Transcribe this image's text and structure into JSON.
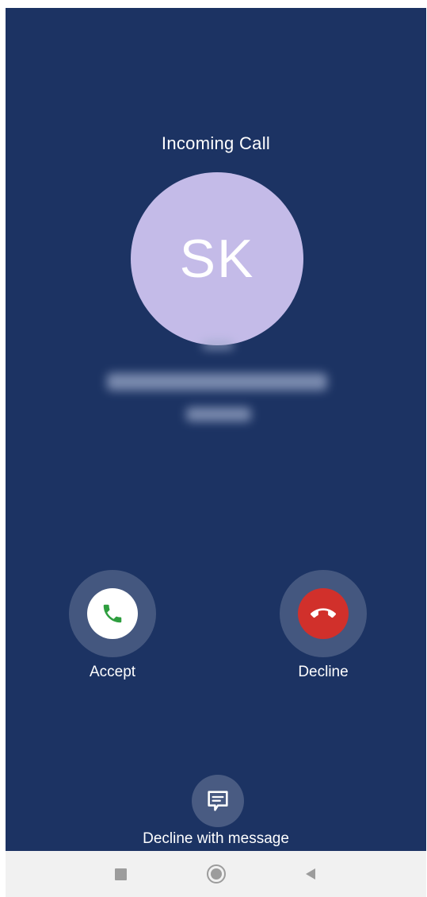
{
  "call": {
    "title": "Incoming Call",
    "avatar_initials": "SK",
    "caller_name": "Sadhana Krishnamurthy",
    "caller_number": "50279",
    "caller_label": "Mob"
  },
  "actions": {
    "accept_label": "Accept",
    "decline_label": "Decline",
    "message_label": "Decline with message"
  },
  "colors": {
    "background": "#1c3363",
    "avatar": "#c4bbe8",
    "accept_icon": "#2e9e3f",
    "decline": "#d1302b"
  },
  "icons": {
    "accept": "phone-icon",
    "decline": "hang-up-icon",
    "message": "message-icon",
    "nav_recent": "square-icon",
    "nav_home": "circle-icon",
    "nav_back": "triangle-back-icon"
  }
}
